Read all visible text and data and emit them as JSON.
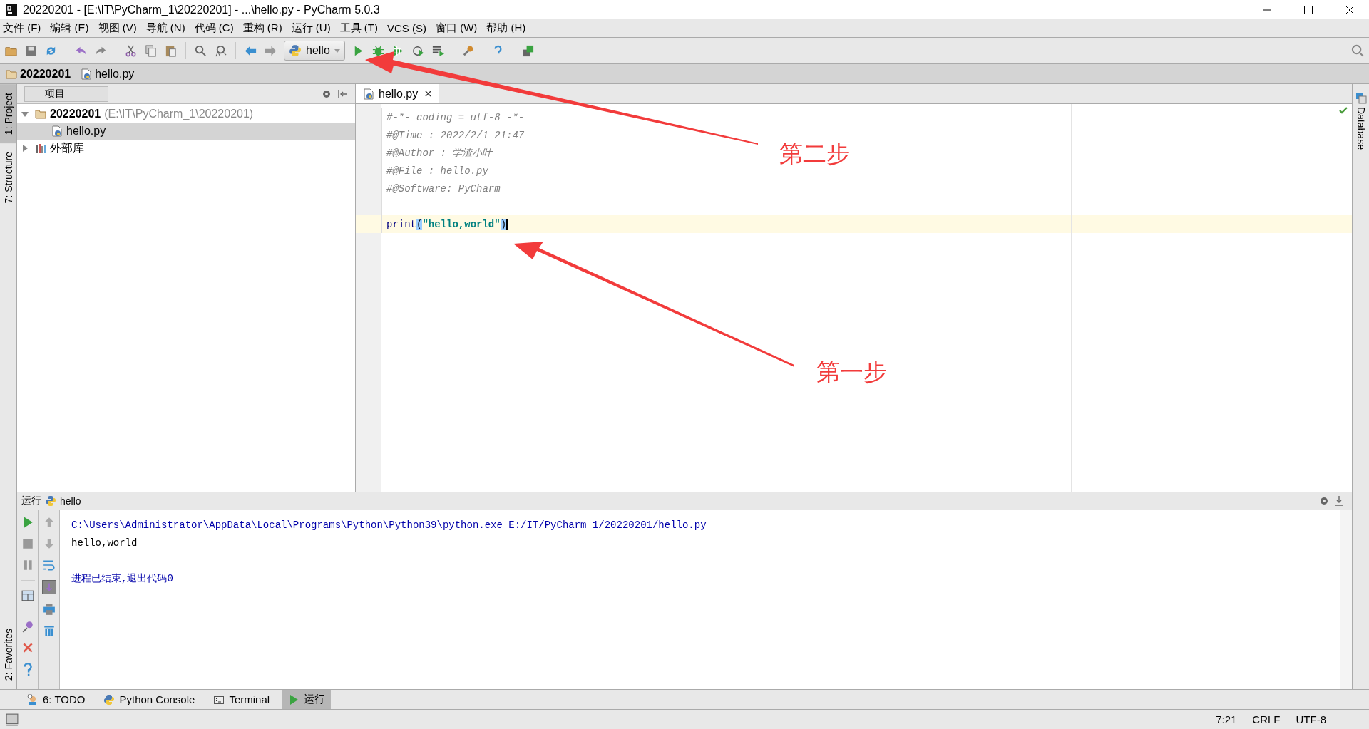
{
  "window": {
    "title": "20220201 - [E:\\IT\\PyCharm_1\\20220201] - ...\\hello.py - PyCharm 5.0.3"
  },
  "menu": [
    "文件 (F)",
    "编辑 (E)",
    "视图 (V)",
    "导航 (N)",
    "代码 (C)",
    "重构 (R)",
    "运行 (U)",
    "工具 (T)",
    "VCS (S)",
    "窗口 (W)",
    "帮助 (H)"
  ],
  "toolbar": {
    "run_config": "hello"
  },
  "breadcrumb": [
    {
      "label": "20220201",
      "kind": "folder"
    },
    {
      "label": "hello.py",
      "kind": "file"
    }
  ],
  "left_tool_tabs": [
    {
      "label": "1: Project",
      "selected": true
    },
    {
      "label": "7: Structure",
      "selected": false
    }
  ],
  "left_bottom_tabs": [
    {
      "label": "2: Favorites",
      "selected": false
    }
  ],
  "project": {
    "header": "项目",
    "tree": [
      {
        "label": "20220201",
        "path": "(E:\\IT\\PyCharm_1\\20220201)",
        "kind": "folder",
        "expanded": true,
        "selected": false,
        "children": [
          {
            "label": "hello.py",
            "kind": "file",
            "selected": true
          }
        ]
      },
      {
        "label": "外部库",
        "kind": "library",
        "expanded": false,
        "selected": false
      }
    ]
  },
  "editor": {
    "tabs": [
      {
        "label": "hello.py",
        "selected": true
      }
    ],
    "lines": [
      {
        "kind": "comment",
        "text": "#-*- coding = utf-8 -*-"
      },
      {
        "kind": "comment",
        "text": "#@Time : 2022/2/1 21:47"
      },
      {
        "kind": "comment",
        "text": "#@Author : 学渣小叶"
      },
      {
        "kind": "comment",
        "text": "#@File : hello.py"
      },
      {
        "kind": "comment",
        "text": "#@Software: PyCharm"
      },
      {
        "kind": "blank"
      },
      {
        "kind": "call",
        "func": "print",
        "open": "(",
        "string": "\"hello,world\"",
        "close": ")",
        "current": true
      }
    ]
  },
  "right_tool_tabs": [
    {
      "label": "Database"
    }
  ],
  "run_panel": {
    "title": "运行",
    "config": "hello",
    "lines": [
      {
        "kind": "command",
        "text": "C:\\Users\\Administrator\\AppData\\Local\\Programs\\Python\\Python39\\python.exe E:/IT/PyCharm_1/20220201/hello.py"
      },
      {
        "kind": "output",
        "text": "hello,world"
      },
      {
        "kind": "blank"
      },
      {
        "kind": "exit",
        "text": "进程已结束,退出代码0"
      }
    ]
  },
  "bottom_tabs": [
    {
      "label": "6: TODO",
      "kind": "todo",
      "selected": false
    },
    {
      "label": "Python Console",
      "kind": "python",
      "selected": false
    },
    {
      "label": "Terminal",
      "kind": "terminal",
      "selected": false
    },
    {
      "label": "运行",
      "kind": "run",
      "selected": true
    }
  ],
  "status_bar": {
    "position": "7:21",
    "line_separator": "CRLF",
    "encoding": "UTF-8"
  },
  "annotations": [
    {
      "text": "第二步"
    },
    {
      "text": "第一步"
    }
  ]
}
